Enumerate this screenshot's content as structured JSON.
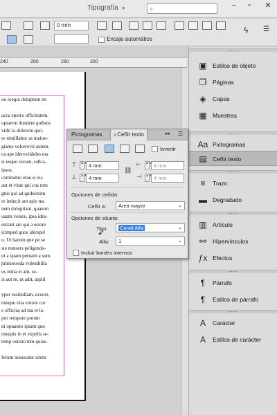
{
  "app": {
    "workspace": "Tipografía",
    "search_placeholder": ""
  },
  "control_bar": {
    "inset_value": "0 mm",
    "auto_fit_label": "Encaje automático"
  },
  "ruler": {
    "ticks": [
      "240",
      "260",
      "280",
      "300"
    ]
  },
  "document": {
    "lines": [
      "ue esequi doluptum en",
      "",
      "acca eperro officitatem.",
      "uptatem dundent quibust",
      "vidit la dolorem quo-",
      "re nimillabor as maion-",
      "giame volorrovit autem.",
      "os ape ideroviideles ma",
      "st esquo verum, odica-",
      "ipsus.",
      "commimo erae si eu-",
      "aut et vitae qui cus rem",
      "gnis qui ad quibestum",
      "re inducir aut apis ma",
      "nem doluptiam, quatem",
      "uaam volore, ipsa ides-",
      "estiant am qui a estore",
      "icimped quos iderspel",
      "o. Ut harum que pe se",
      "sie nonsers peligendu-",
      "ut a quam pernam a sum",
      "pratureseda volenihilla",
      "us nima et am, se-",
      "is aut re, ut adit, aspid",
      "",
      "yper essinullam, occust,",
      "nseque vita volore cor",
      "e officius ad ma et la-",
      "por rempore porem",
      "ni optaesto ipsant quo",
      "nsequis in et expelis se-",
      "temp ostisto tem quias-",
      "",
      "ferum nonecatur sitem"
    ]
  },
  "panel": {
    "tabs": [
      "Pictogramas",
      "Ceñir texto"
    ],
    "invert_label": "Invertir",
    "offsets": [
      "4 mm",
      "4 mm",
      "4 mm",
      "4 mm"
    ],
    "wrap_options_title": "Opciones de ceñido:",
    "wrap_to_label": "Ceñir a:",
    "wrap_to_value": "Área mayor",
    "contour_title": "Opciones de silueta:",
    "type_label": "Tipo:",
    "type_value": "Canal Alfa",
    "alpha_label": "Alfa:",
    "alpha_value": "1",
    "include_edges_label": "Incluir bordes internos"
  },
  "dock": {
    "items": [
      {
        "label": "Estilos de objeto",
        "icon": "object-styles-icon"
      },
      {
        "label": "Páginas",
        "icon": "pages-icon"
      },
      {
        "label": "Capas",
        "icon": "layers-icon"
      },
      {
        "label": "Muestras",
        "icon": "swatches-icon"
      },
      {
        "label": "Pictogramas",
        "icon": "glyphs-icon"
      },
      {
        "label": "Ceñir texto",
        "icon": "text-wrap-icon"
      },
      {
        "label": "Trazo",
        "icon": "stroke-icon"
      },
      {
        "label": "Degradado",
        "icon": "gradient-icon"
      },
      {
        "label": "Artículo",
        "icon": "articles-icon"
      },
      {
        "label": "Hipervínculos",
        "icon": "hyperlinks-icon"
      },
      {
        "label": "Efectos",
        "icon": "effects-icon"
      },
      {
        "label": "Párrafo",
        "icon": "paragraph-icon"
      },
      {
        "label": "Estilos de párrafo",
        "icon": "paragraph-styles-icon"
      },
      {
        "label": "Carácter",
        "icon": "character-icon"
      },
      {
        "label": "Estilos de carácter",
        "icon": "character-styles-icon"
      }
    ]
  },
  "colors": {
    "frame_edge": "#d96bd9",
    "selection": "#3a7fe0",
    "active_tab": "#b9b9b9"
  }
}
